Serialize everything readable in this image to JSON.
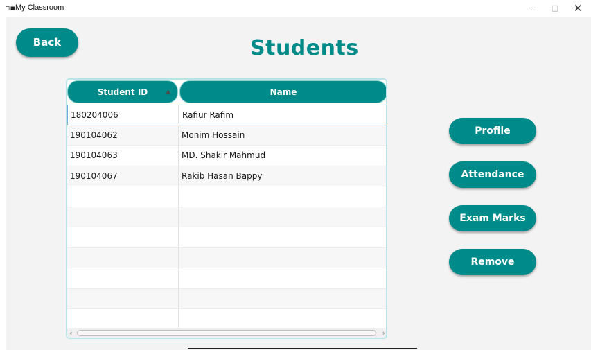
{
  "window": {
    "title": "My Classroom",
    "controls": {
      "minimize": "–",
      "maximize": "□",
      "close": "✕"
    }
  },
  "header": {
    "back_label": "Back",
    "title": "Students"
  },
  "table": {
    "columns": [
      "Student ID",
      "Name"
    ],
    "sort": {
      "column": "Student ID",
      "direction": "ascending"
    },
    "rows": [
      {
        "id": "180204006",
        "name": "Rafiur Rafim",
        "selected": true
      },
      {
        "id": "190104062",
        "name": "Monim Hossain"
      },
      {
        "id": "190104063",
        "name": "MD. Shakir Mahmud"
      },
      {
        "id": "190104067",
        "name": "Rakib Hasan Bappy"
      }
    ]
  },
  "actions": {
    "profile": "Profile",
    "attendance": "Attendance",
    "exam_marks": "Exam Marks",
    "remove": "Remove"
  },
  "colors": {
    "accent": "#008b8b",
    "background": "#f3f3f3",
    "selection_border": "#6fa8dc"
  }
}
